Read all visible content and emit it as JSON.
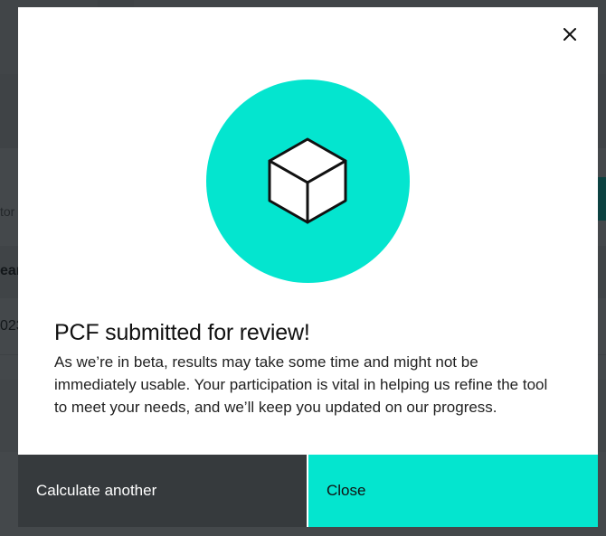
{
  "background": {
    "label_fragment": "tor",
    "table_header_fragment": "ear",
    "table_row_fragment": "023"
  },
  "modal": {
    "title": "PCF submitted for review!",
    "body": "As we’re in beta, results may take some time and might not be immediately usable. Your participation is vital in helping us refine the tool to meet your needs, and we’ll keep you updated on our progress.",
    "icons": {
      "close": "close-icon",
      "hero": "cube-icon"
    },
    "buttons": {
      "secondary_label": "Calculate another",
      "primary_label": "Close"
    },
    "colors": {
      "accent": "#04e5cf",
      "secondary_button": "#363a3d",
      "overlay": "rgba(15,20,24,0.78)"
    }
  }
}
